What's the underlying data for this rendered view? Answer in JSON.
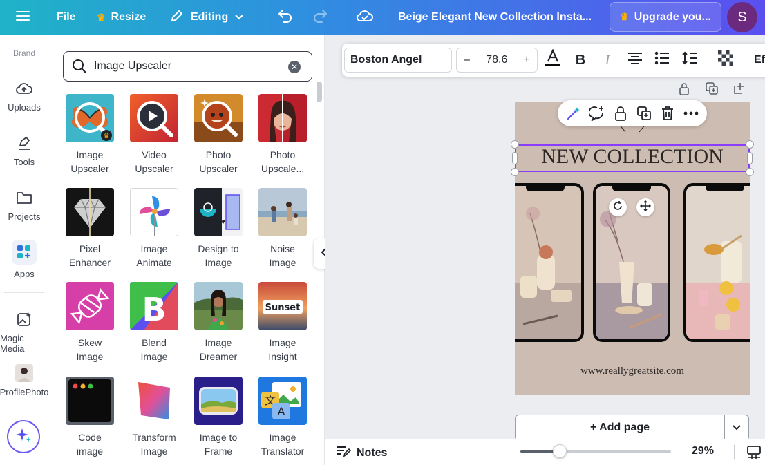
{
  "topbar": {
    "file": "File",
    "resize": "Resize",
    "editing": "Editing",
    "doc_title": "Beige Elegant New Collection Insta...",
    "upgrade": "Upgrade you...",
    "avatar_letter": "S"
  },
  "rail": {
    "brand": "Brand",
    "uploads": "Uploads",
    "tools": "Tools",
    "projects": "Projects",
    "apps": "Apps",
    "magic_media": "Magic Media",
    "profile_photo": "ProfilePhoto"
  },
  "search": {
    "value": "Image Upscaler"
  },
  "apps": [
    {
      "name": "Image\nUpscaler"
    },
    {
      "name": "Video\nUpscaler"
    },
    {
      "name": "Photo\nUpscaler"
    },
    {
      "name": "Photo\nUpscale..."
    },
    {
      "name": "Pixel\nEnhancer"
    },
    {
      "name": "Image\nAnimate"
    },
    {
      "name": "Design to\nImage"
    },
    {
      "name": "Noise\nImage"
    },
    {
      "name": "Skew\nImage"
    },
    {
      "name": "Blend\nImage"
    },
    {
      "name": "Image\nDreamer"
    },
    {
      "name": "Image\nInsight"
    },
    {
      "name": "Code\nimage"
    },
    {
      "name": "Transform\nImage"
    },
    {
      "name": "Image to\nFrame"
    },
    {
      "name": "Image\nTranslator"
    }
  ],
  "thumb_text": {
    "sunset": "Sunset",
    "blend_letter": "B"
  },
  "toolbar": {
    "font": "Boston Angel",
    "font_size": "78.6",
    "minus": "–",
    "plus": "+",
    "effects": "Ef"
  },
  "design": {
    "title": "NEW COLLECTION",
    "site": "www.reallygreatsite.com"
  },
  "add_page": "+ Add page",
  "bottombar": {
    "notes": "Notes",
    "zoom": "29%",
    "zoom_fraction": 0.29
  }
}
